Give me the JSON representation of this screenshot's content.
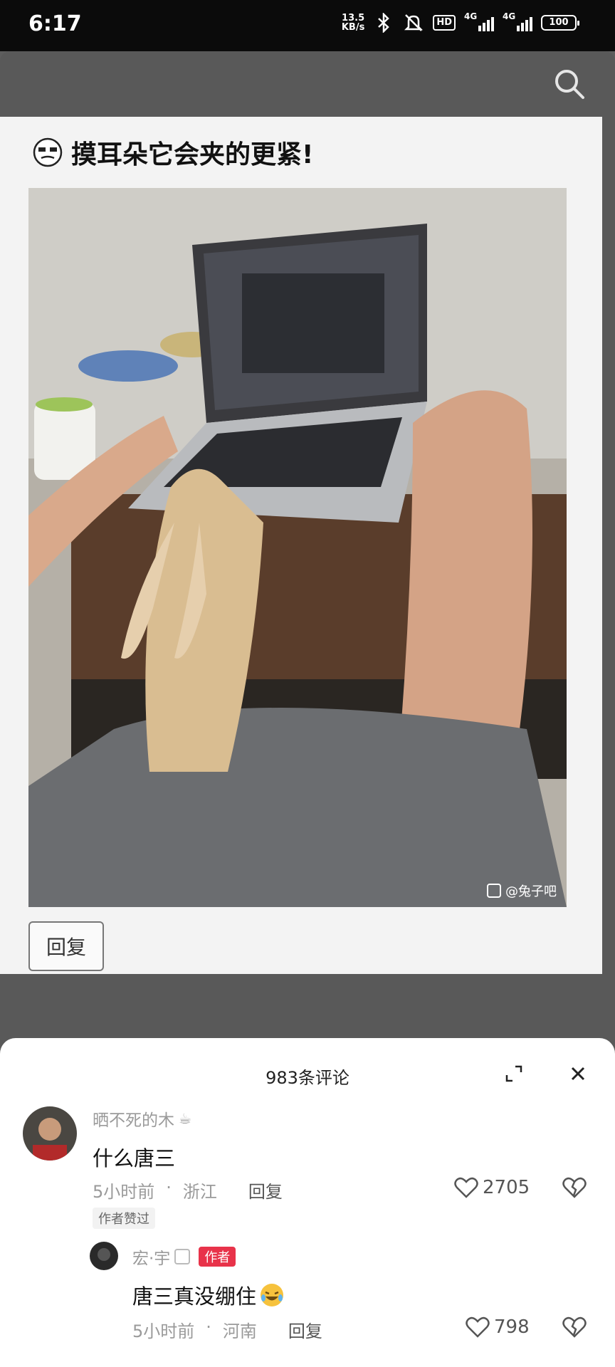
{
  "status_bar": {
    "time": "6:17",
    "net_speed_value": "13.5",
    "net_speed_unit": "KB/s",
    "hd": "HD",
    "network_1": "4G",
    "network_2": "4G",
    "battery": "100"
  },
  "post": {
    "caption": "摸耳朵它会夹的更紧!",
    "watermark": "@兔子吧",
    "reply_label": "回复"
  },
  "comments_sheet": {
    "title": "983条评论",
    "comments": [
      {
        "username": "晒不死的木",
        "text": "什么唐三",
        "time": "5小时前",
        "location": "浙江",
        "reply_label": "回复",
        "likes": "2705",
        "badge": "作者赞过"
      },
      {
        "username": "宏·宇",
        "author_tag": "作者",
        "text": "唐三真没绷住",
        "time": "5小时前",
        "location": "河南",
        "reply_label": "回复",
        "likes": "798"
      }
    ]
  },
  "icons": {
    "search": "search-icon",
    "expand": "expand-icon",
    "close": "close-icon",
    "heart": "heart-icon",
    "dislike": "broken-heart-icon"
  }
}
